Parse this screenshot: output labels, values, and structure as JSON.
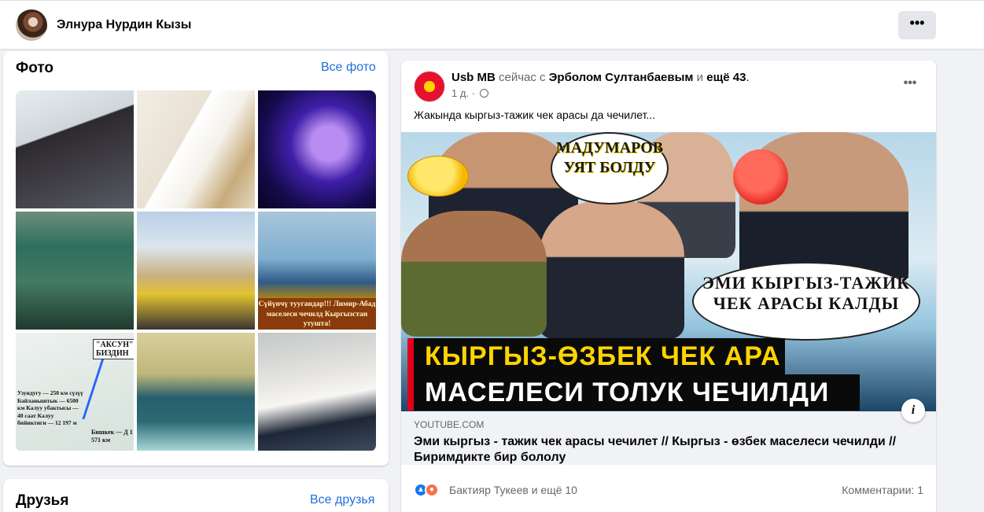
{
  "profile": {
    "name": "Элнура Нурдин Кызы",
    "more_label": "•••"
  },
  "photos": {
    "title": "Фото",
    "see_all": "Все фото",
    "items": [
      {
        "caption": ""
      },
      {
        "caption": ""
      },
      {
        "caption": ""
      },
      {
        "caption": ""
      },
      {
        "caption": ""
      },
      {
        "caption": "Сүйүнчү туугандар!!! Лимир-Абад маселеси чечилд Кыргызстан утушта!"
      },
      {
        "map_label": "\"АКСУН\" БИЗДИН",
        "stats": "Узундугу — 250 км сүзүү  Байланыштык — 6500 км  Калуу убактысы — 40 саат  Калуу бийиктиги — 12 197 м",
        "city": "Бишкек — Д  1 571 км"
      },
      {
        "caption": ""
      },
      {
        "caption": ""
      }
    ]
  },
  "friends": {
    "title": "Друзья",
    "see_all": "Все друзья"
  },
  "post": {
    "author": "Usb MB",
    "status_text": " сейчас с ",
    "tagged": "Эрболом Султанбаевым",
    "and_more": " и ",
    "more_count": "ещё 43",
    "dot": ".",
    "time": "1 д. · ",
    "more_label": "•••",
    "text": "Жакында кыргыз-тажик чек арасы да чечилет...",
    "thumbnail": {
      "bubble_left": "МАДУМАРОВ УЯТ БОЛДУ",
      "bubble_right": "ЭМИ КЫРГЫЗ-ТАЖИК ЧЕК АРАСЫ КАЛДЫ",
      "banner_top": "КЫРГЫЗ-ӨЗБЕК ЧЕК АРА",
      "banner_bottom": "МАСЕЛЕСИ ТОЛУК ЧЕЧИЛДИ"
    },
    "link_domain": "YOUTUBE.COM",
    "link_title": "Эми кыргыз - тажик чек арасы чечилет // Кыргыз - өзбек маселеси чечилди // Биримдикте бир бололу",
    "info_label": "i",
    "reactors": "Бактияр Тукеев и ещё 10",
    "comments": "Комментарии: 1"
  },
  "colors": {
    "link": "#216fdb",
    "muted": "#65676b",
    "like": "#1877f2",
    "angry": "#f7714b",
    "page_bg": "#f0f2f5"
  }
}
